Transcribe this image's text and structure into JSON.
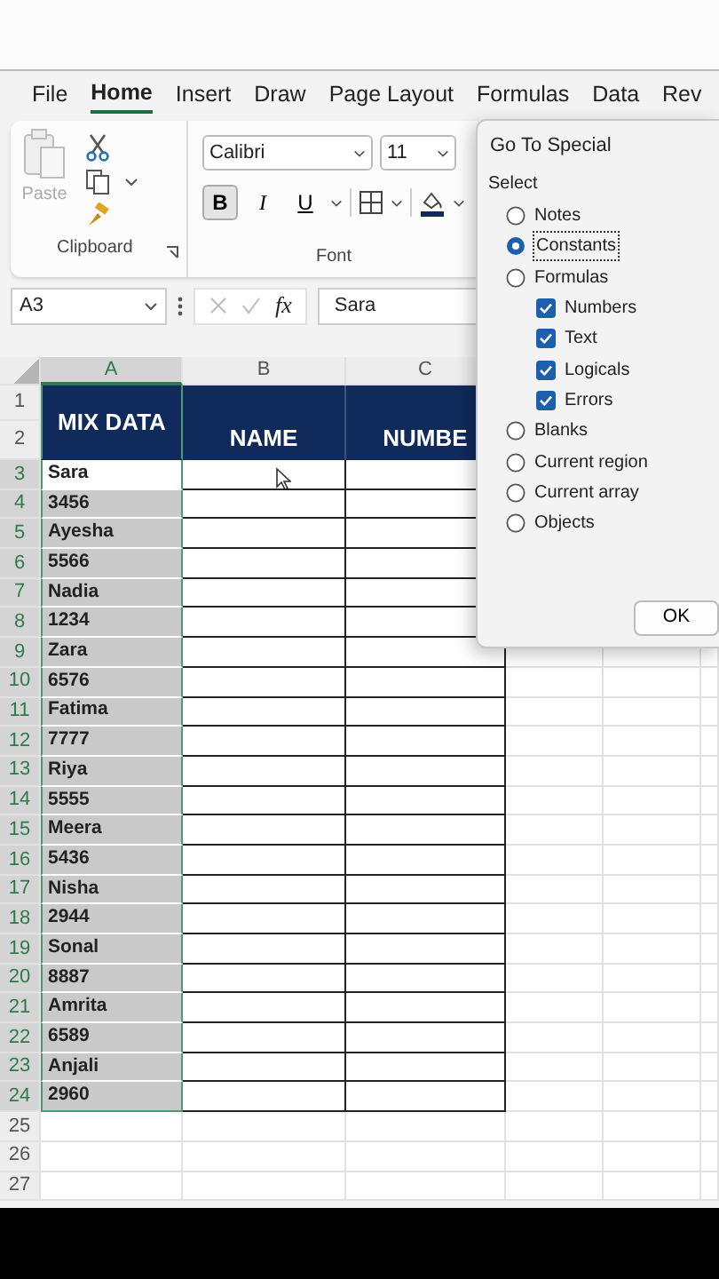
{
  "ribbon_tabs": [
    {
      "label": "File",
      "selected": false
    },
    {
      "label": "Home",
      "selected": true
    },
    {
      "label": "Insert",
      "selected": false
    },
    {
      "label": "Draw",
      "selected": false
    },
    {
      "label": "Page Layout",
      "selected": false
    },
    {
      "label": "Formulas",
      "selected": false
    },
    {
      "label": "Data",
      "selected": false
    },
    {
      "label": "Rev",
      "selected": false
    }
  ],
  "clipboard": {
    "paste_label": "Paste",
    "paste_disabled": true,
    "group_label": "Clipboard"
  },
  "font": {
    "name": "Calibri",
    "size": "11",
    "group_label": "Font",
    "format_buttons": [
      {
        "label": "B",
        "kind": "bold",
        "pressed": true
      },
      {
        "label": "I",
        "kind": "italic",
        "pressed": false
      },
      {
        "label": "U",
        "kind": "underline",
        "pressed": false
      }
    ]
  },
  "formula_bar": {
    "name_box": "A3",
    "function_label": "fx",
    "value": "Sara"
  },
  "sheet": {
    "columns": [
      {
        "label": "A",
        "selected": true
      },
      {
        "label": "B",
        "selected": false
      },
      {
        "label": "C",
        "selected": false
      }
    ],
    "header": [
      "MIX DATA",
      "NAME",
      "NUMBE"
    ],
    "rows": [
      {
        "number": "1",
        "kind": "header",
        "selected": false
      },
      {
        "number": "2",
        "kind": "header",
        "selected": false
      },
      {
        "number": "3",
        "kind": "data",
        "selected": true,
        "active": true,
        "value": "Sara"
      },
      {
        "number": "4",
        "kind": "data",
        "selected": true,
        "active": false,
        "value": "3456"
      },
      {
        "number": "5",
        "kind": "data",
        "selected": true,
        "active": false,
        "value": "Ayesha"
      },
      {
        "number": "6",
        "kind": "data",
        "selected": true,
        "active": false,
        "value": "5566"
      },
      {
        "number": "7",
        "kind": "data",
        "selected": true,
        "active": false,
        "value": "Nadia"
      },
      {
        "number": "8",
        "kind": "data",
        "selected": true,
        "active": false,
        "value": "1234"
      },
      {
        "number": "9",
        "kind": "data",
        "selected": true,
        "active": false,
        "value": "Zara"
      },
      {
        "number": "10",
        "kind": "data",
        "selected": true,
        "active": false,
        "value": "6576"
      },
      {
        "number": "11",
        "kind": "data",
        "selected": true,
        "active": false,
        "value": "Fatima"
      },
      {
        "number": "12",
        "kind": "data",
        "selected": true,
        "active": false,
        "value": "7777"
      },
      {
        "number": "13",
        "kind": "data",
        "selected": true,
        "active": false,
        "value": "Riya"
      },
      {
        "number": "14",
        "kind": "data",
        "selected": true,
        "active": false,
        "value": "5555"
      },
      {
        "number": "15",
        "kind": "data",
        "selected": true,
        "active": false,
        "value": "Meera"
      },
      {
        "number": "16",
        "kind": "data",
        "selected": true,
        "active": false,
        "value": "5436"
      },
      {
        "number": "17",
        "kind": "data",
        "selected": true,
        "active": false,
        "value": "Nisha"
      },
      {
        "number": "18",
        "kind": "data",
        "selected": true,
        "active": false,
        "value": "2944"
      },
      {
        "number": "19",
        "kind": "data",
        "selected": true,
        "active": false,
        "value": "Sonal"
      },
      {
        "number": "20",
        "kind": "data",
        "selected": true,
        "active": false,
        "value": "8887"
      },
      {
        "number": "21",
        "kind": "data",
        "selected": true,
        "active": false,
        "value": "Amrita"
      },
      {
        "number": "22",
        "kind": "data",
        "selected": true,
        "active": false,
        "value": "6589"
      },
      {
        "number": "23",
        "kind": "data",
        "selected": true,
        "active": false,
        "value": "Anjali"
      },
      {
        "number": "24",
        "kind": "data",
        "selected": true,
        "active": false,
        "value": "2960"
      },
      {
        "number": "25",
        "kind": "empty",
        "selected": false
      },
      {
        "number": "26",
        "kind": "empty",
        "selected": false
      },
      {
        "number": "27",
        "kind": "empty",
        "selected": false
      }
    ]
  },
  "dialog": {
    "title": "Go To Special",
    "group_label": "Select",
    "options": [
      {
        "label": "Notes",
        "selected": false
      },
      {
        "label": "Constants",
        "selected": true
      },
      {
        "label": "Formulas",
        "selected": false,
        "children": [
          {
            "label": "Numbers",
            "checked": true
          },
          {
            "label": "Text",
            "checked": true
          },
          {
            "label": "Logicals",
            "checked": true
          },
          {
            "label": "Errors",
            "checked": true
          }
        ]
      },
      {
        "label": "Blanks",
        "selected": false
      },
      {
        "label": "Current region",
        "selected": false
      },
      {
        "label": "Current array",
        "selected": false
      },
      {
        "label": "Objects",
        "selected": false
      }
    ],
    "buttons": [
      "OK"
    ]
  }
}
